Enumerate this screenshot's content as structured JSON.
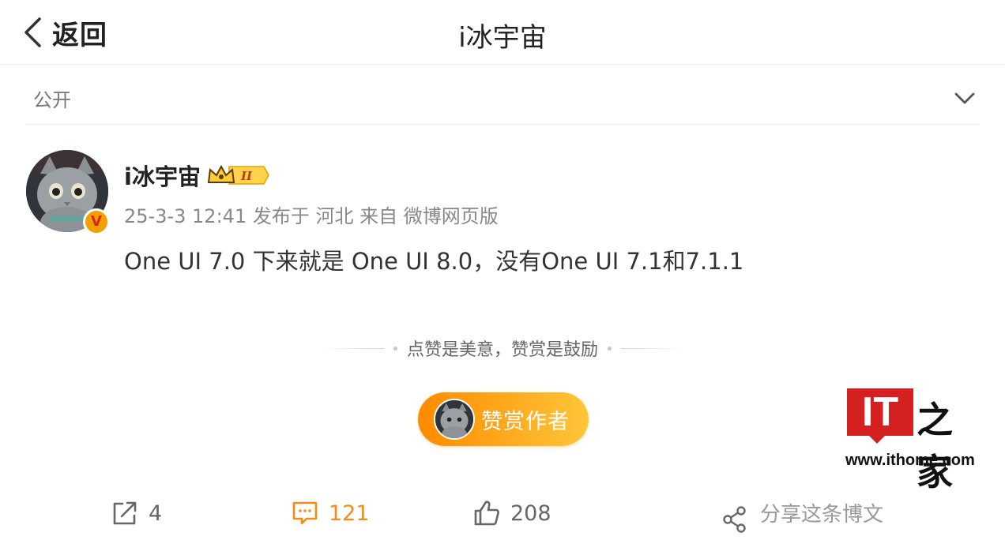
{
  "header": {
    "back_label": "返回",
    "title": "i冰宇宙"
  },
  "visibility": {
    "label": "公开"
  },
  "post": {
    "author_name": "i冰宇宙",
    "vip_level": "II",
    "verified_mark": "V",
    "meta": "25-3-3 12:41  发布于 河北  来自 微博网页版",
    "content": "One UI 7.0 下来就是 One UI 8.0，没有One UI 7.1和7.1.1"
  },
  "reward": {
    "tip": "点赞是美意，赞赏是鼓励",
    "button_label": "赞赏作者"
  },
  "actions": {
    "repost_count": "4",
    "comment_count": "121",
    "like_count": "208",
    "share_label": "分享这条博文"
  },
  "watermark": {
    "logo_text": "IT",
    "logo_cn": "之家",
    "url": "www.ithome.com"
  },
  "colors": {
    "accent_orange": "#f78c15",
    "reward_gradient_start": "#ff8a00",
    "reward_gradient_end": "#ffc63a",
    "watermark_red": "#d42020"
  },
  "icons": [
    "back-chevron-icon",
    "chevron-down-icon",
    "repost-icon",
    "comment-icon",
    "like-icon",
    "share-icon"
  ]
}
